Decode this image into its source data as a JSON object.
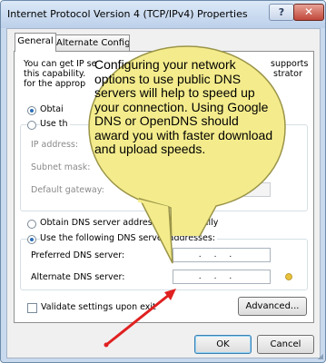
{
  "window": {
    "title": "Internet Protocol Version 4 (TCP/IPv4) Properties",
    "help_label": "?",
    "close_label": "✕"
  },
  "tabs": [
    {
      "label": "General",
      "selected": true
    },
    {
      "label": "Alternate Configuration",
      "selected": false
    }
  ],
  "general": {
    "intro_line1": "You can get IP se",
    "intro_line1_end": "supports",
    "intro_line2": "this capability.",
    "intro_line2_end": "strator",
    "intro_line3": "for the approp",
    "obtain_ip_label": "Obtai",
    "use_ip_label": "Use th",
    "ip_address_label": "IP address:",
    "subnet_mask_label": "Subnet mask:",
    "default_gateway_label": "Default gateway:",
    "obtain_dns_label": "Obtain DNS server address automatically",
    "use_dns_label": "Use the following DNS server addresses:",
    "preferred_dns_label": "Preferred DNS server:",
    "alternate_dns_label": "Alternate DNS server:",
    "ip_placeholder": "...",
    "preferred_dns_value": "...",
    "alternate_dns_value": "...",
    "validate_label": "Validate settings upon exit",
    "advanced_label": "Advanced..."
  },
  "footer": {
    "ok_label": "OK",
    "cancel_label": "Cancel"
  },
  "callout": {
    "text": "Configuring your network options to use public DNS servers will help to speed up your connection. Using Google DNS or OpenDNS should award you with faster download and upload speeds."
  },
  "colors": {
    "callout_fill": "#f4ec8c",
    "callout_stroke": "#9a9448",
    "arrow": "#e02020",
    "radio_dot": "#2d6fb8"
  }
}
